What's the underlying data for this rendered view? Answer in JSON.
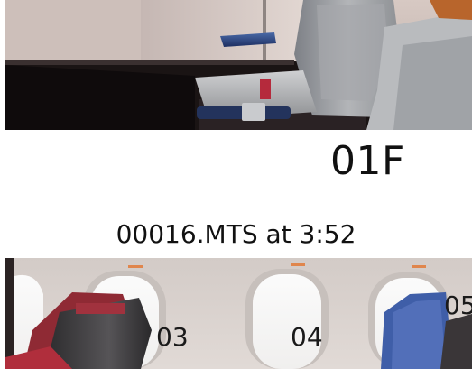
{
  "top_photo": {
    "seat_label": "01F"
  },
  "caption": "00016.MTS at 3:52",
  "bottom_photo": {
    "row_labels": [
      "03",
      "04",
      "05"
    ]
  }
}
